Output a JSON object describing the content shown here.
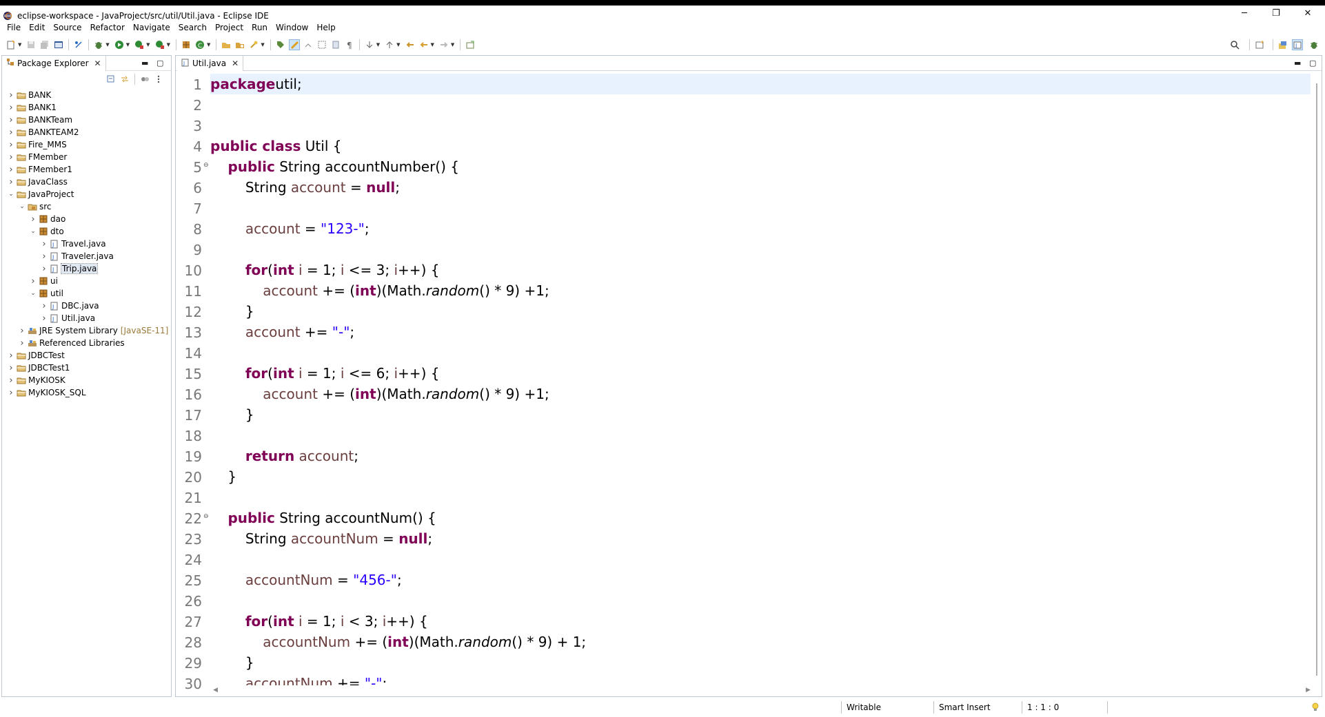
{
  "window": {
    "title": "eclipse-workspace - JavaProject/src/util/Util.java - Eclipse IDE",
    "minimize": "─",
    "restore": "❐",
    "close": "✕"
  },
  "menu": [
    "File",
    "Edit",
    "Source",
    "Refactor",
    "Navigate",
    "Search",
    "Project",
    "Run",
    "Window",
    "Help"
  ],
  "package_explorer": {
    "tab_label": "Package Explorer",
    "tree": [
      {
        "label": "BANK",
        "depth": 0,
        "expanded": false,
        "kind": "project"
      },
      {
        "label": "BANK1",
        "depth": 0,
        "expanded": false,
        "kind": "project"
      },
      {
        "label": "BANKTeam",
        "depth": 0,
        "expanded": false,
        "kind": "project"
      },
      {
        "label": "BANKTEAM2",
        "depth": 0,
        "expanded": false,
        "kind": "project"
      },
      {
        "label": "Fire_MMS",
        "depth": 0,
        "expanded": false,
        "kind": "project"
      },
      {
        "label": "FMember",
        "depth": 0,
        "expanded": false,
        "kind": "project"
      },
      {
        "label": "FMember1",
        "depth": 0,
        "expanded": false,
        "kind": "project"
      },
      {
        "label": "JavaClass",
        "depth": 0,
        "expanded": false,
        "kind": "project"
      },
      {
        "label": "JavaProject",
        "depth": 0,
        "expanded": true,
        "kind": "project"
      },
      {
        "label": "src",
        "depth": 1,
        "expanded": true,
        "kind": "srcfolder"
      },
      {
        "label": "dao",
        "depth": 2,
        "expanded": false,
        "kind": "package"
      },
      {
        "label": "dto",
        "depth": 2,
        "expanded": true,
        "kind": "package"
      },
      {
        "label": "Travel.java",
        "depth": 3,
        "expanded": false,
        "kind": "javafile"
      },
      {
        "label": "Traveler.java",
        "depth": 3,
        "expanded": false,
        "kind": "javafile"
      },
      {
        "label": "Trip.java",
        "depth": 3,
        "expanded": false,
        "kind": "javafile",
        "selected": true
      },
      {
        "label": "ui",
        "depth": 2,
        "expanded": false,
        "kind": "package"
      },
      {
        "label": "util",
        "depth": 2,
        "expanded": true,
        "kind": "package"
      },
      {
        "label": "DBC.java",
        "depth": 3,
        "expanded": false,
        "kind": "javafile"
      },
      {
        "label": "Util.java",
        "depth": 3,
        "expanded": false,
        "kind": "javafile"
      },
      {
        "label": "JRE System Library",
        "suffix": "[JavaSE-11]",
        "depth": 1,
        "expanded": false,
        "kind": "library"
      },
      {
        "label": "Referenced Libraries",
        "depth": 1,
        "expanded": false,
        "kind": "library"
      },
      {
        "label": "JDBCTest",
        "depth": 0,
        "expanded": false,
        "kind": "project"
      },
      {
        "label": "JDBCTest1",
        "depth": 0,
        "expanded": false,
        "kind": "project"
      },
      {
        "label": "MyKIOSK",
        "depth": 0,
        "expanded": false,
        "kind": "project"
      },
      {
        "label": "MyKIOSK_SQL",
        "depth": 0,
        "expanded": false,
        "kind": "project"
      }
    ]
  },
  "editor": {
    "tab_label": "Util.java",
    "lines": [
      {
        "n": "1",
        "fold": "",
        "segs": [
          [
            "kw",
            "package"
          ],
          [
            "",
            "util;"
          ]
        ]
      },
      {
        "n": "2",
        "fold": "",
        "segs": []
      },
      {
        "n": "3",
        "fold": "",
        "segs": []
      },
      {
        "n": "4",
        "fold": "",
        "segs": [
          [
            "kw",
            "public class"
          ],
          [
            "",
            " Util {"
          ]
        ]
      },
      {
        "n": "5",
        "fold": "⊖",
        "segs": [
          [
            "",
            "    "
          ],
          [
            "kw",
            "public"
          ],
          [
            "",
            " String accountNumber() {"
          ]
        ]
      },
      {
        "n": "6",
        "fold": "",
        "segs": [
          [
            "",
            "        String "
          ],
          [
            "var",
            "account"
          ],
          [
            "",
            " = "
          ],
          [
            "kw",
            "null"
          ],
          [
            "",
            ";"
          ]
        ]
      },
      {
        "n": "7",
        "fold": "",
        "segs": []
      },
      {
        "n": "8",
        "fold": "",
        "segs": [
          [
            "",
            "        "
          ],
          [
            "var",
            "account"
          ],
          [
            "",
            " = "
          ],
          [
            "str",
            "\"123-\""
          ],
          [
            "",
            ";"
          ]
        ]
      },
      {
        "n": "9",
        "fold": "",
        "segs": []
      },
      {
        "n": "10",
        "fold": "",
        "segs": [
          [
            "",
            "        "
          ],
          [
            "kw",
            "for"
          ],
          [
            "",
            "("
          ],
          [
            "kw",
            "int"
          ],
          [
            "var",
            " i"
          ],
          [
            "",
            " = 1; "
          ],
          [
            "var",
            "i"
          ],
          [
            "",
            " <= 3; "
          ],
          [
            "var",
            "i"
          ],
          [
            "",
            "++) {"
          ]
        ]
      },
      {
        "n": "11",
        "fold": "",
        "segs": [
          [
            "",
            "            "
          ],
          [
            "var",
            "account"
          ],
          [
            "",
            " += ("
          ],
          [
            "kw",
            "int"
          ],
          [
            "",
            ")(Math."
          ],
          [
            "ital",
            "random"
          ],
          [
            "",
            "() * 9) +1;"
          ]
        ]
      },
      {
        "n": "12",
        "fold": "",
        "segs": [
          [
            "",
            "        }"
          ]
        ]
      },
      {
        "n": "13",
        "fold": "",
        "segs": [
          [
            "",
            "        "
          ],
          [
            "var",
            "account"
          ],
          [
            "",
            " += "
          ],
          [
            "str",
            "\"-\""
          ],
          [
            "",
            ";"
          ]
        ]
      },
      {
        "n": "14",
        "fold": "",
        "segs": []
      },
      {
        "n": "15",
        "fold": "",
        "segs": [
          [
            "",
            "        "
          ],
          [
            "kw",
            "for"
          ],
          [
            "",
            "("
          ],
          [
            "kw",
            "int"
          ],
          [
            "var",
            " i"
          ],
          [
            "",
            " = 1; "
          ],
          [
            "var",
            "i"
          ],
          [
            "",
            " <= 6; "
          ],
          [
            "var",
            "i"
          ],
          [
            "",
            "++) {"
          ]
        ]
      },
      {
        "n": "16",
        "fold": "",
        "segs": [
          [
            "",
            "            "
          ],
          [
            "var",
            "account"
          ],
          [
            "",
            " += ("
          ],
          [
            "kw",
            "int"
          ],
          [
            "",
            ")(Math."
          ],
          [
            "ital",
            "random"
          ],
          [
            "",
            "() * 9) +1;"
          ]
        ]
      },
      {
        "n": "17",
        "fold": "",
        "segs": [
          [
            "",
            "        }"
          ]
        ]
      },
      {
        "n": "18",
        "fold": "",
        "segs": []
      },
      {
        "n": "19",
        "fold": "",
        "segs": [
          [
            "",
            "        "
          ],
          [
            "kw",
            "return"
          ],
          [
            "var",
            " account"
          ],
          [
            "",
            ";"
          ]
        ]
      },
      {
        "n": "20",
        "fold": "",
        "segs": [
          [
            "",
            "    }"
          ]
        ]
      },
      {
        "n": "21",
        "fold": "",
        "segs": []
      },
      {
        "n": "22",
        "fold": "⊖",
        "segs": [
          [
            "",
            "    "
          ],
          [
            "kw",
            "public"
          ],
          [
            "",
            " String accountNum() {"
          ]
        ]
      },
      {
        "n": "23",
        "fold": "",
        "segs": [
          [
            "",
            "        String "
          ],
          [
            "var",
            "accountNum"
          ],
          [
            "",
            " = "
          ],
          [
            "kw",
            "null"
          ],
          [
            "",
            ";"
          ]
        ]
      },
      {
        "n": "24",
        "fold": "",
        "segs": []
      },
      {
        "n": "25",
        "fold": "",
        "segs": [
          [
            "",
            "        "
          ],
          [
            "var",
            "accountNum"
          ],
          [
            "",
            " = "
          ],
          [
            "str",
            "\"456-\""
          ],
          [
            "",
            ";"
          ]
        ]
      },
      {
        "n": "26",
        "fold": "",
        "segs": []
      },
      {
        "n": "27",
        "fold": "",
        "segs": [
          [
            "",
            "        "
          ],
          [
            "kw",
            "for"
          ],
          [
            "",
            "("
          ],
          [
            "kw",
            "int"
          ],
          [
            "var",
            " i"
          ],
          [
            "",
            " = 1; "
          ],
          [
            "var",
            "i"
          ],
          [
            "",
            " < 3; "
          ],
          [
            "var",
            "i"
          ],
          [
            "",
            "++) {"
          ]
        ]
      },
      {
        "n": "28",
        "fold": "",
        "segs": [
          [
            "",
            "            "
          ],
          [
            "var",
            "accountNum"
          ],
          [
            "",
            " += ("
          ],
          [
            "kw",
            "int"
          ],
          [
            "",
            ")(Math."
          ],
          [
            "ital",
            "random"
          ],
          [
            "",
            "() * 9) + 1;"
          ]
        ]
      },
      {
        "n": "29",
        "fold": "",
        "segs": [
          [
            "",
            "        }"
          ]
        ]
      },
      {
        "n": "30",
        "fold": "",
        "segs": [
          [
            "",
            "        "
          ],
          [
            "var",
            "accountNum"
          ],
          [
            "",
            " += "
          ],
          [
            "str",
            "\"-\""
          ],
          [
            "",
            ";"
          ]
        ]
      }
    ]
  },
  "status": {
    "mode": "Writable",
    "insert": "Smart Insert",
    "position": "1 : 1 : 0"
  }
}
